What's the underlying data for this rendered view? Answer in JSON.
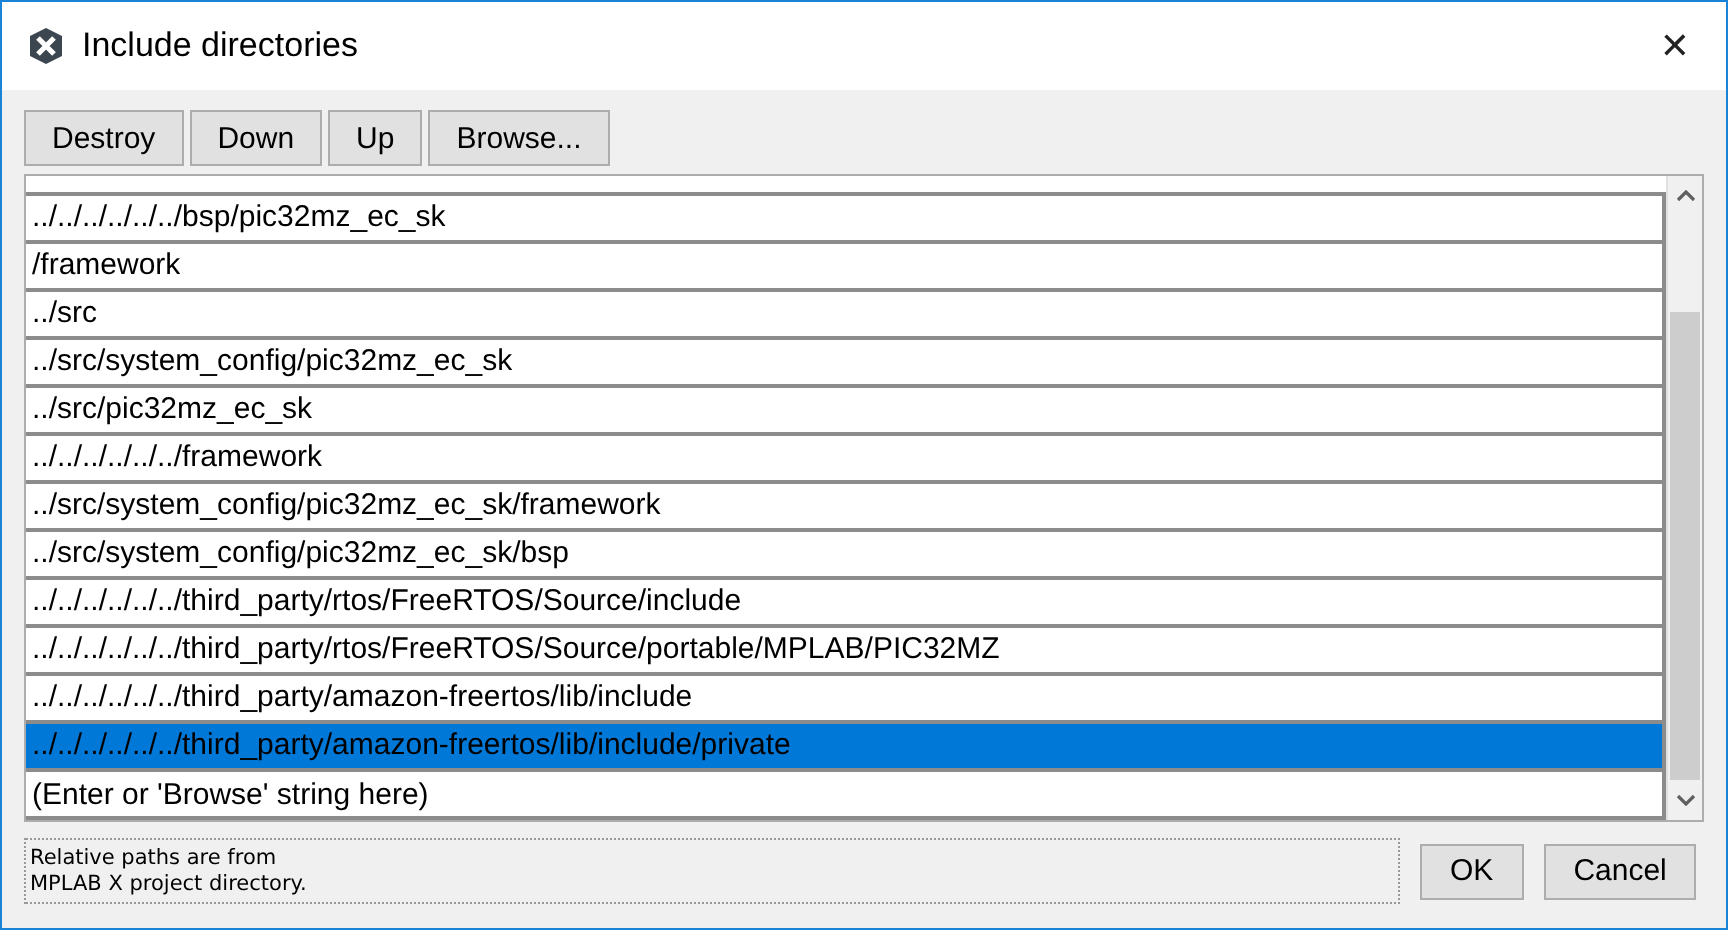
{
  "window": {
    "title": "Include directories",
    "close": "✕"
  },
  "toolbar": [
    "Destroy",
    "Down",
    "Up",
    "Browse..."
  ],
  "rows": [
    {
      "text": "../../../../../../bsp/pic32mz_ec_sk",
      "selected": false
    },
    {
      "text": "/framework",
      "selected": false
    },
    {
      "text": "../src",
      "selected": false
    },
    {
      "text": "../src/system_config/pic32mz_ec_sk",
      "selected": false
    },
    {
      "text": "../src/pic32mz_ec_sk",
      "selected": false
    },
    {
      "text": "../../../../../../framework",
      "selected": false
    },
    {
      "text": "../src/system_config/pic32mz_ec_sk/framework",
      "selected": false
    },
    {
      "text": "../src/system_config/pic32mz_ec_sk/bsp",
      "selected": false
    },
    {
      "text": "../../../../../../third_party/rtos/FreeRTOS/Source/include",
      "selected": false
    },
    {
      "text": "../../../../../../third_party/rtos/FreeRTOS/Source/portable/MPLAB/PIC32MZ",
      "selected": false
    },
    {
      "text": "../../../../../../third_party/amazon-freertos/lib/include",
      "selected": false
    },
    {
      "text": "../../../../../../third_party/amazon-freertos/lib/include/private",
      "selected": true
    }
  ],
  "new_entry": {
    "placeholder": "(Enter or 'Browse' string here)"
  },
  "note": [
    "Relative paths are from",
    "MPLAB X project directory."
  ],
  "buttons": [
    "OK",
    "Cancel"
  ]
}
